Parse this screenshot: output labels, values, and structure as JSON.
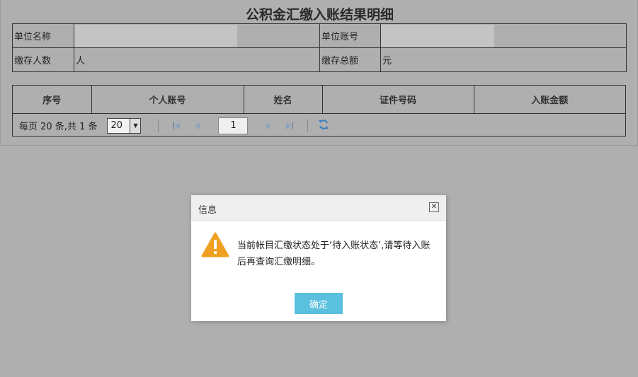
{
  "page": {
    "title": "公积金汇缴入账结果明细"
  },
  "info": {
    "unit_name_label": "单位名称",
    "unit_account_label": "单位账号",
    "count_label": "缴存人数",
    "count_unit": "人",
    "total_label": "缴存总额",
    "total_unit": "元"
  },
  "grid": {
    "columns": [
      "序号",
      "个人账号",
      "姓名",
      "证件号码",
      "入账金额"
    ]
  },
  "pager": {
    "summary": "每页 20 条,共 1 条",
    "page_size": "20",
    "current_page": "1"
  },
  "dialog": {
    "title": "信息",
    "message": "当前帐目汇缴状态处于‘待入账状态’,请等待入账后再查询汇缴明细。",
    "ok_label": "确定"
  },
  "colors": {
    "warning": "#f0a020",
    "button": "#5bc0de"
  }
}
